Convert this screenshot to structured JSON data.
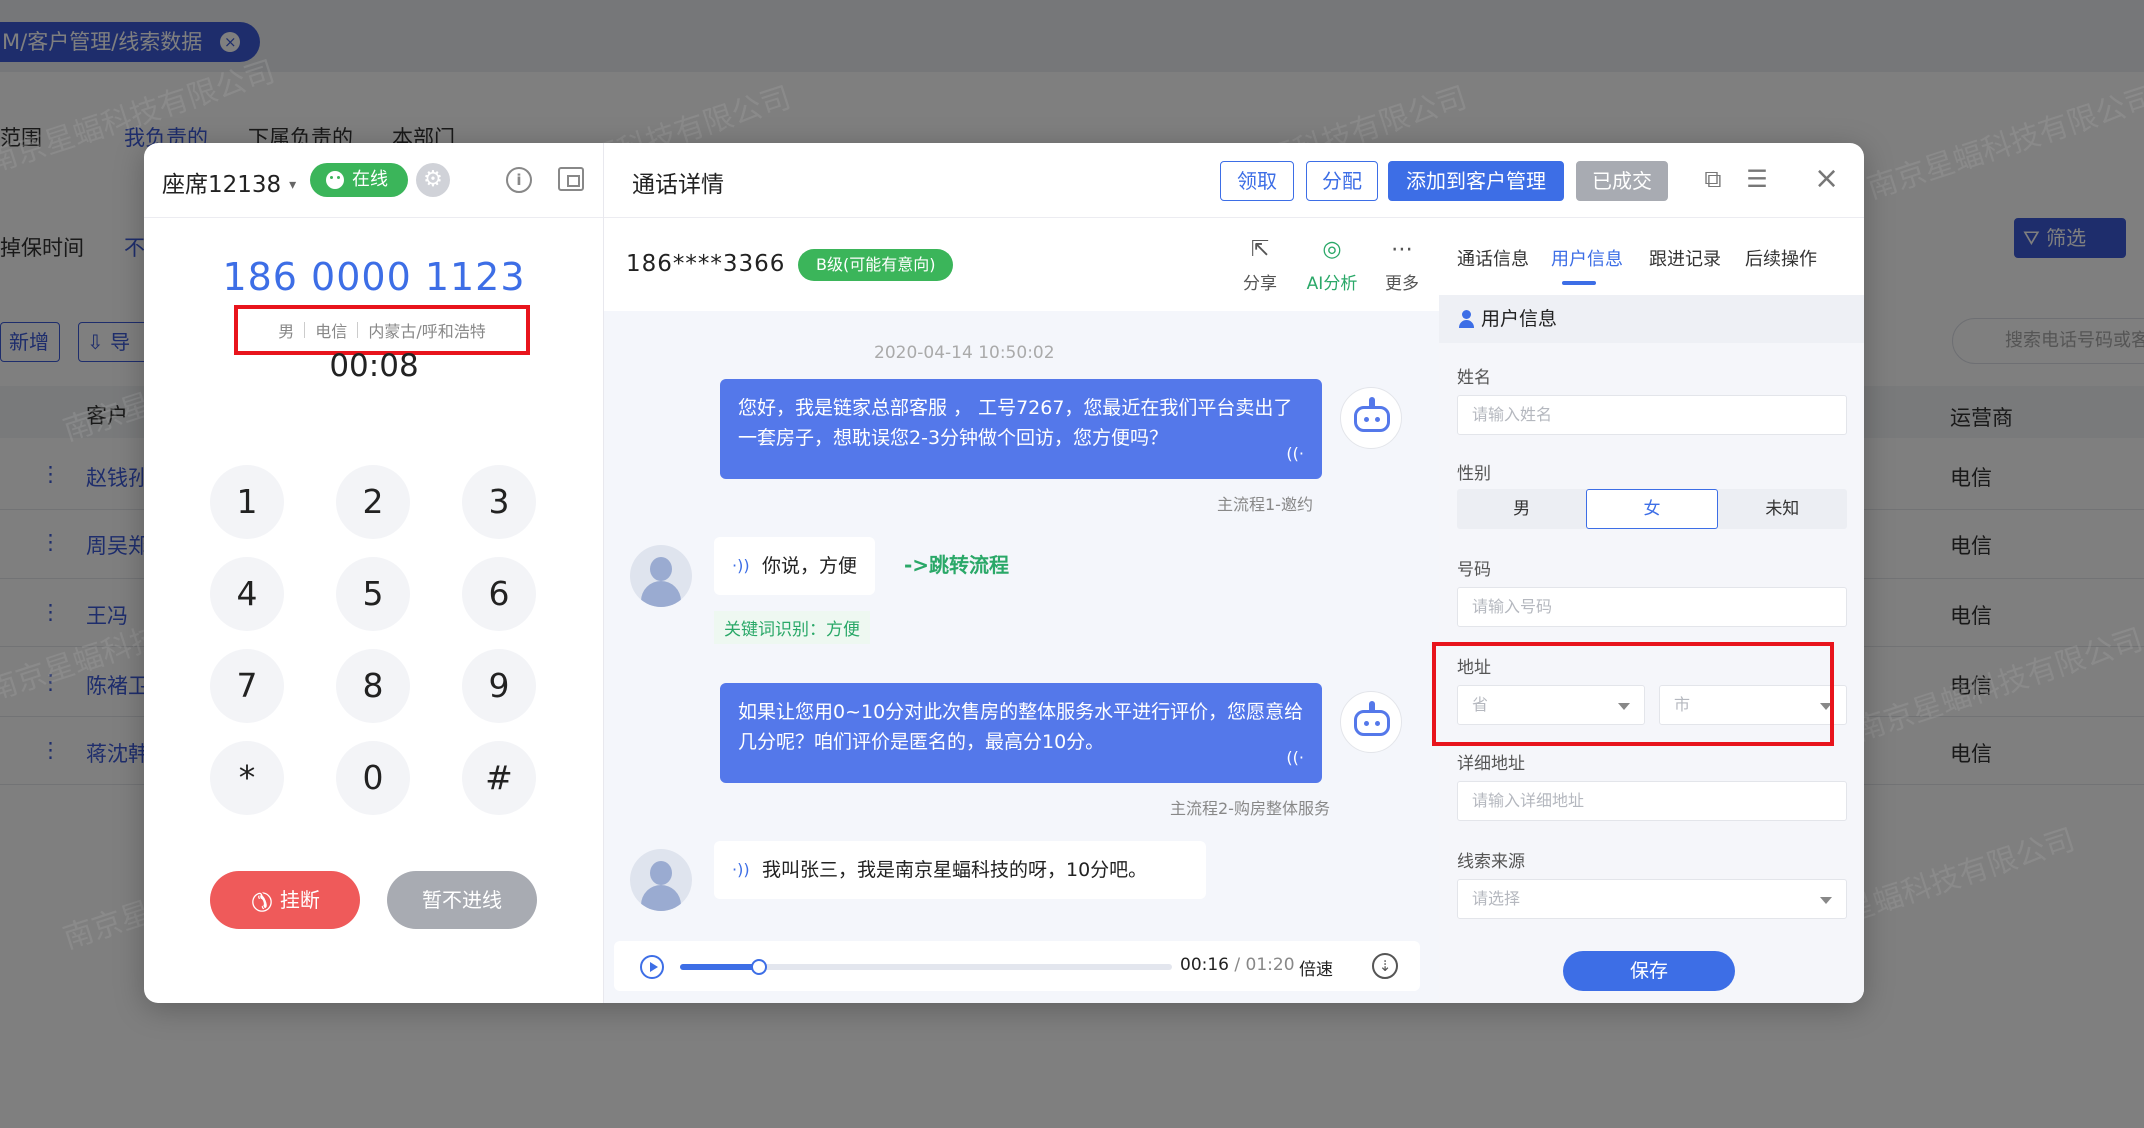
{
  "background": {
    "tab_path": "M/客户管理/线索数据",
    "row_scope_label": "范围",
    "scope_tabs": [
      "我负责的",
      "下属负责的",
      "本部门"
    ],
    "row_time_label": "掉保时间",
    "row_time_value": "不",
    "add_button": "新增",
    "import_button": "导",
    "filter_button": "筛选",
    "search_placeholder": "搜索电话号码或客",
    "col_customer": "客户",
    "col_carrier": "运营商",
    "rows": [
      {
        "name": "赵钱孙",
        "carrier": "电信"
      },
      {
        "name": "周吴郑",
        "carrier": "电信"
      },
      {
        "name": "王冯",
        "carrier": "电信"
      },
      {
        "name": "陈褚卫",
        "carrier": "电信"
      },
      {
        "name": "蒋沈韩",
        "carrier": "电信"
      }
    ],
    "watermark": "南京星蝠科技有限公司"
  },
  "dialer": {
    "seat": "座席12138",
    "status": "在线",
    "phone": "186 0000 1123",
    "gender": "男",
    "carrier": "电信",
    "region": "内蒙古/呼和浩特",
    "timer": "00:08",
    "keys": [
      "1",
      "2",
      "3",
      "4",
      "5",
      "6",
      "7",
      "8",
      "9",
      "*",
      "0",
      "#"
    ],
    "hangup": "挂断",
    "skip": "暂不进线"
  },
  "call": {
    "title": "通话详情",
    "buttons": {
      "claim": "领取",
      "assign": "分配",
      "add_to_crm": "添加到客户管理",
      "closed": "已成交"
    },
    "callee": "186****3366",
    "grade": "B级(可能有意向)",
    "tools": {
      "share": "分享",
      "ai": "AI分析",
      "more": "更多"
    },
    "timestamp": "2020-04-14  10:50:02",
    "messages": {
      "bot1": "您好，我是链家总部客服 ， 工号7267，您最近在我们平台卖出了一套房子，想耽误您2-3分钟做个回访，您方便吗？",
      "bot1_flow": "主流程1-邀约",
      "user1": "你说，方便",
      "user1_jump": "->跳转流程",
      "user1_keyword": "关键词识别：方便",
      "bot2": "如果让您用0~10分对此次售房的整体服务水平进行评价，您愿意给几分呢？咱们评价是匿名的，最高分10分。",
      "bot2_flow": "主流程2-购房整体服务",
      "user2": "我叫张三，我是南京星蝠科技的呀，10分吧。"
    },
    "player": {
      "current": "00:16",
      "separator": " / ",
      "total": "01:20",
      "speed": "倍速",
      "progress_fraction": 0.16
    }
  },
  "user_info": {
    "tabs": [
      "通话信息",
      "用户信息",
      "跟进记录",
      "后续操作"
    ],
    "section": "用户信息",
    "name_label": "姓名",
    "name_placeholder": "请输入姓名",
    "gender_label": "性别",
    "gender_options": [
      "男",
      "女",
      "未知"
    ],
    "number_label": "号码",
    "number_placeholder": "请输入号码",
    "address_label": "地址",
    "province_placeholder": "省",
    "city_placeholder": "市",
    "detail_label": "详细地址",
    "detail_placeholder": "请输入详细地址",
    "source_label": "线索来源",
    "source_placeholder": "请选择",
    "save": "保存"
  },
  "colors": {
    "primary": "#3d6ee6",
    "online": "#3bb55a",
    "hangup": "#ef5a5a",
    "highlight": "#e8141c"
  }
}
